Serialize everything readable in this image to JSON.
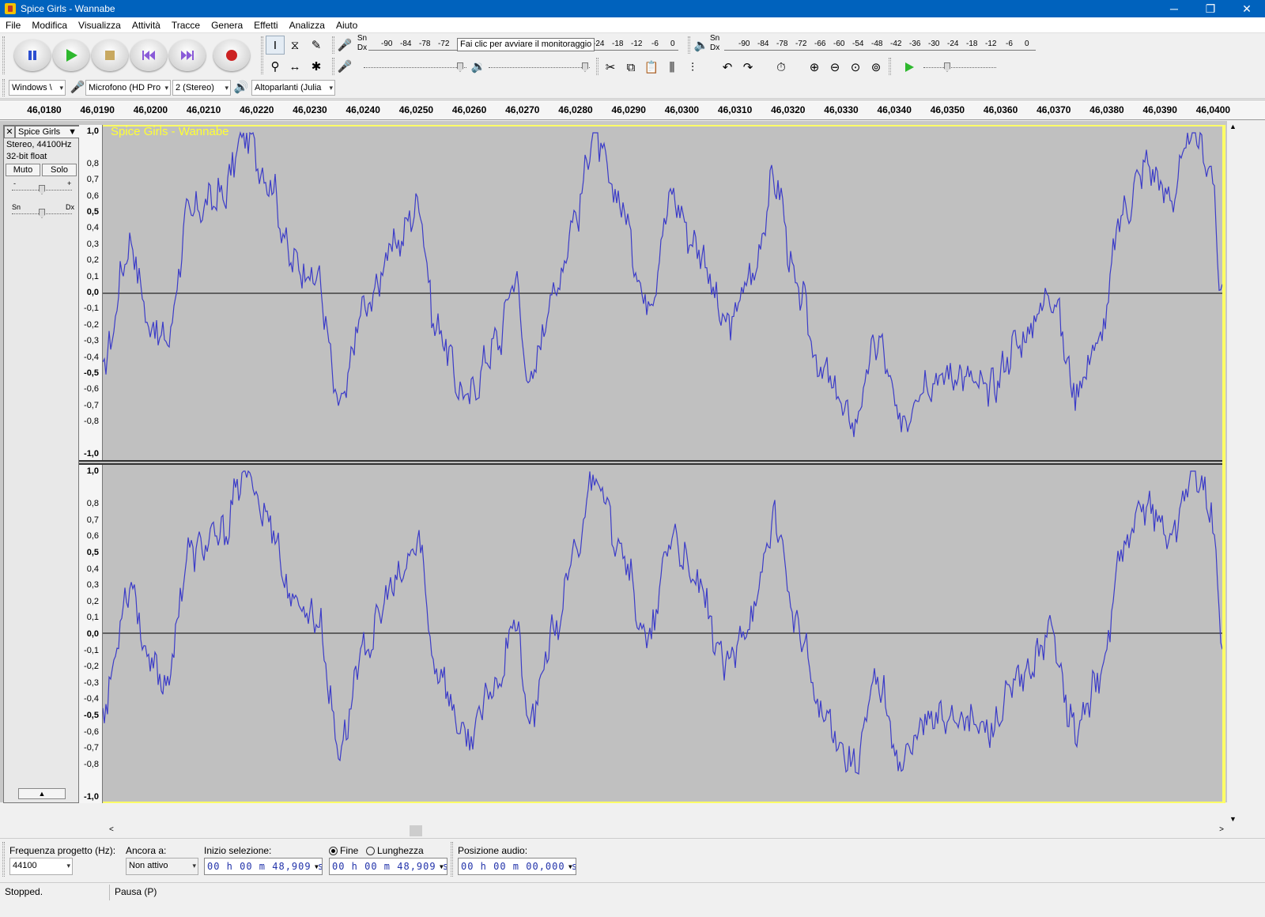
{
  "window": {
    "title": "Spice Girls - Wannabe",
    "minimize": "─",
    "restore": "❐",
    "close": "✕"
  },
  "menu": [
    "File",
    "Modifica",
    "Visualizza",
    "Attività",
    "Tracce",
    "Genera",
    "Effetti",
    "Analizza",
    "Aiuto"
  ],
  "transport": {
    "pause": "pause-icon",
    "play": "play-icon",
    "stop": "stop-icon",
    "skip_start": "skip-start-icon",
    "skip_end": "skip-end-icon",
    "record": "record-icon"
  },
  "meters": {
    "record_ch": [
      "Sn",
      "Dx"
    ],
    "record_scale": [
      "-90",
      "-84",
      "-78",
      "-72",
      "-24",
      "-18",
      "-12",
      "-6",
      "0"
    ],
    "monitor_hint": "Fai clic per avviare il monitoraggio",
    "play_ch": [
      "Sn",
      "Dx"
    ],
    "play_scale": [
      "-90",
      "-84",
      "-78",
      "-72",
      "-66",
      "-60",
      "-54",
      "-48",
      "-42",
      "-36",
      "-30",
      "-24",
      "-18",
      "-12",
      "-6",
      "0"
    ]
  },
  "device": {
    "host": "Windows \\",
    "mic": "Microfono (HD Pro",
    "channels": "2 (Stereo)",
    "speakers": "Altoparlanti (Julia"
  },
  "ruler": [
    "46,0180",
    "46,0190",
    "46,0200",
    "46,0210",
    "46,0220",
    "46,0230",
    "46,0240",
    "46,0250",
    "46,0260",
    "46,0270",
    "46,0280",
    "46,0290",
    "46,0300",
    "46,0310",
    "46,0320",
    "46,0330",
    "46,0340",
    "46,0350",
    "46,0360",
    "46,0370",
    "46,0380",
    "46,0390",
    "46,0400"
  ],
  "track": {
    "close": "✕",
    "name": "Spice Girls",
    "format": "Stereo, 44100Hz",
    "bits": "32-bit float",
    "mute": "Muto",
    "solo": "Solo",
    "gain_min": "-",
    "gain_max": "+",
    "pan_left": "Sn",
    "pan_right": "Dx",
    "title": "Spice Girls - Wannabe",
    "gain_level": 0.5,
    "pan_level": 0.5
  },
  "amp_labels": [
    "1,0",
    "0,8",
    "0,7",
    "0,6",
    "0,5",
    "0,4",
    "0,3",
    "0,2",
    "0,1",
    "0,0",
    "-0,1",
    "-0,2",
    "-0,3",
    "-0,4",
    "-0,5",
    "-0,6",
    "-0,7",
    "-0,8",
    "-1,0"
  ],
  "waveform_color": "#3c3cc8",
  "selection": {
    "rate_label": "Frequenza progetto (Hz):",
    "rate": "44100",
    "snap_label": "Ancora a:",
    "snap": "Non attivo",
    "start_label": "Inizio selezione:",
    "end_label": "Fine",
    "length_label": "Lunghezza",
    "start": "00 h 00 m 48,909 s",
    "end": "00 h 00 m 48,909 s",
    "pos_label": "Posizione audio:",
    "pos": "00 h 00 m 00,000 s"
  },
  "status": {
    "left": "Stopped.",
    "right": "Pausa (P)"
  }
}
